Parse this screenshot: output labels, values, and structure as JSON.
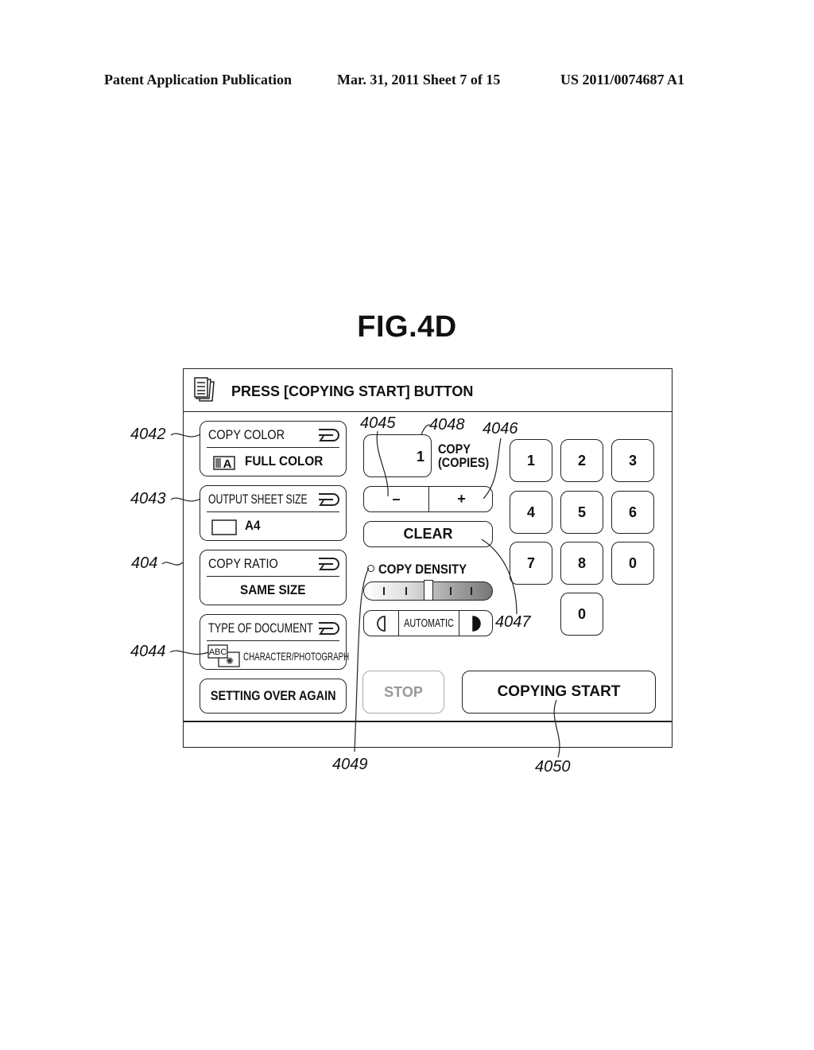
{
  "page_header": {
    "left": "Patent Application Publication",
    "middle": "Mar. 31, 2011  Sheet 7 of 15",
    "right": "US 2011/0074687 A1"
  },
  "figure_label": "FIG.4D",
  "screen": {
    "title_icon": "document-stack-icon",
    "title": "PRESS [COPYING START] BUTTON",
    "settings": [
      {
        "title": "COPY COLOR",
        "value": "FULL COLOR",
        "icon": "color-mode-icon"
      },
      {
        "title": "OUTPUT SHEET SIZE",
        "value": "A4",
        "icon": "sheet-icon"
      },
      {
        "title": "COPY RATIO",
        "value": "SAME SIZE"
      },
      {
        "title": "TYPE OF DOCUMENT",
        "value": "CHARACTER/PHOTOGRAPH",
        "icon": "character-photograph-icon"
      }
    ],
    "setting_over_again": "SETTING OVER AGAIN",
    "copies": {
      "value": "1",
      "label_line1": "COPY",
      "label_line2": "(COPIES)"
    },
    "minus_label": "–",
    "plus_label": "+",
    "clear_label": "CLEAR",
    "density": {
      "label": "COPY DENSITY",
      "level": 0.5,
      "automatic_label": "AUTOMATIC"
    },
    "keypad": [
      "1",
      "2",
      "3",
      "4",
      "5",
      "6",
      "7",
      "8",
      "0",
      "0"
    ],
    "stop_label": "STOP",
    "copying_start_label": "COPYING START"
  },
  "callouts": {
    "c4042": "4042",
    "c4043": "4043",
    "c404": "404",
    "c4044": "4044",
    "c4045": "4045",
    "c4048": "4048",
    "c4046": "4046",
    "c4047": "4047",
    "c4049": "4049",
    "c4050": "4050"
  }
}
